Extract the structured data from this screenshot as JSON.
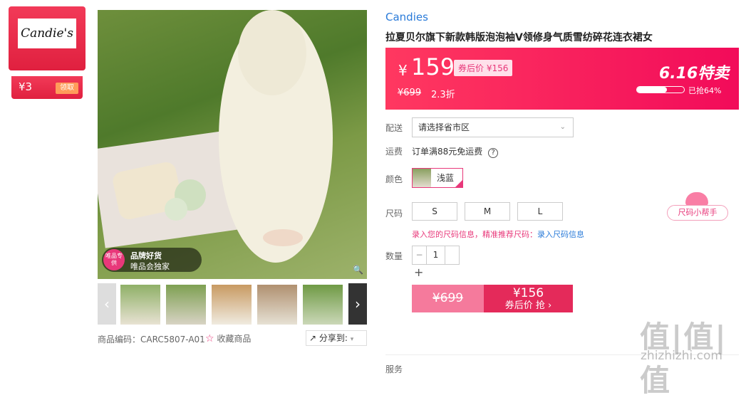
{
  "brand_card": {
    "logo_text": "Candie's",
    "coupon_value": "¥3",
    "coupon_claim": "领取"
  },
  "image_badge": {
    "circle_text": "唯品专供",
    "line1": "品牌好货",
    "line2": "唯品会独家"
  },
  "thumbnails": {
    "prev_icon": "‹",
    "next_icon": "›"
  },
  "sku": {
    "label": "商品编码：",
    "code": "CARC5807-A01"
  },
  "favorite_label": "收藏商品",
  "share_label": "分享到:",
  "brand_name": "Candies",
  "product_title": "拉夏贝尔旗下新款韩版泡泡袖V领修身气质雪纺碎花连衣裙女",
  "price": {
    "currency": "¥",
    "current": "159",
    "after_coupon": "券后价 ¥156",
    "original": "¥699",
    "discount": "2.3折",
    "promo": "6.16特卖",
    "sold_percent_label": "已抢64%",
    "sold_percent": 64
  },
  "delivery": {
    "label": "配送",
    "placeholder": "请选择省市区"
  },
  "shipping": {
    "label": "运费",
    "text": "订单满88元免运费"
  },
  "color": {
    "label": "颜色",
    "option": "浅蓝"
  },
  "size": {
    "label": "尺码",
    "options": [
      "S",
      "M",
      "L"
    ],
    "tip": "录入您的尺码信息，精准推荐尺码：",
    "tip_link": "录入尺码信息",
    "helper": "尺码小帮手"
  },
  "quantity": {
    "label": "数量",
    "minus": "−",
    "value": "1",
    "plus": "+"
  },
  "buy": {
    "original": "¥699",
    "price": "¥156",
    "label": "券后价 抢 ›"
  },
  "services_label": "服务",
  "watermark": {
    "logo": "值|值|值",
    "url": "zhizhizhi.com"
  }
}
